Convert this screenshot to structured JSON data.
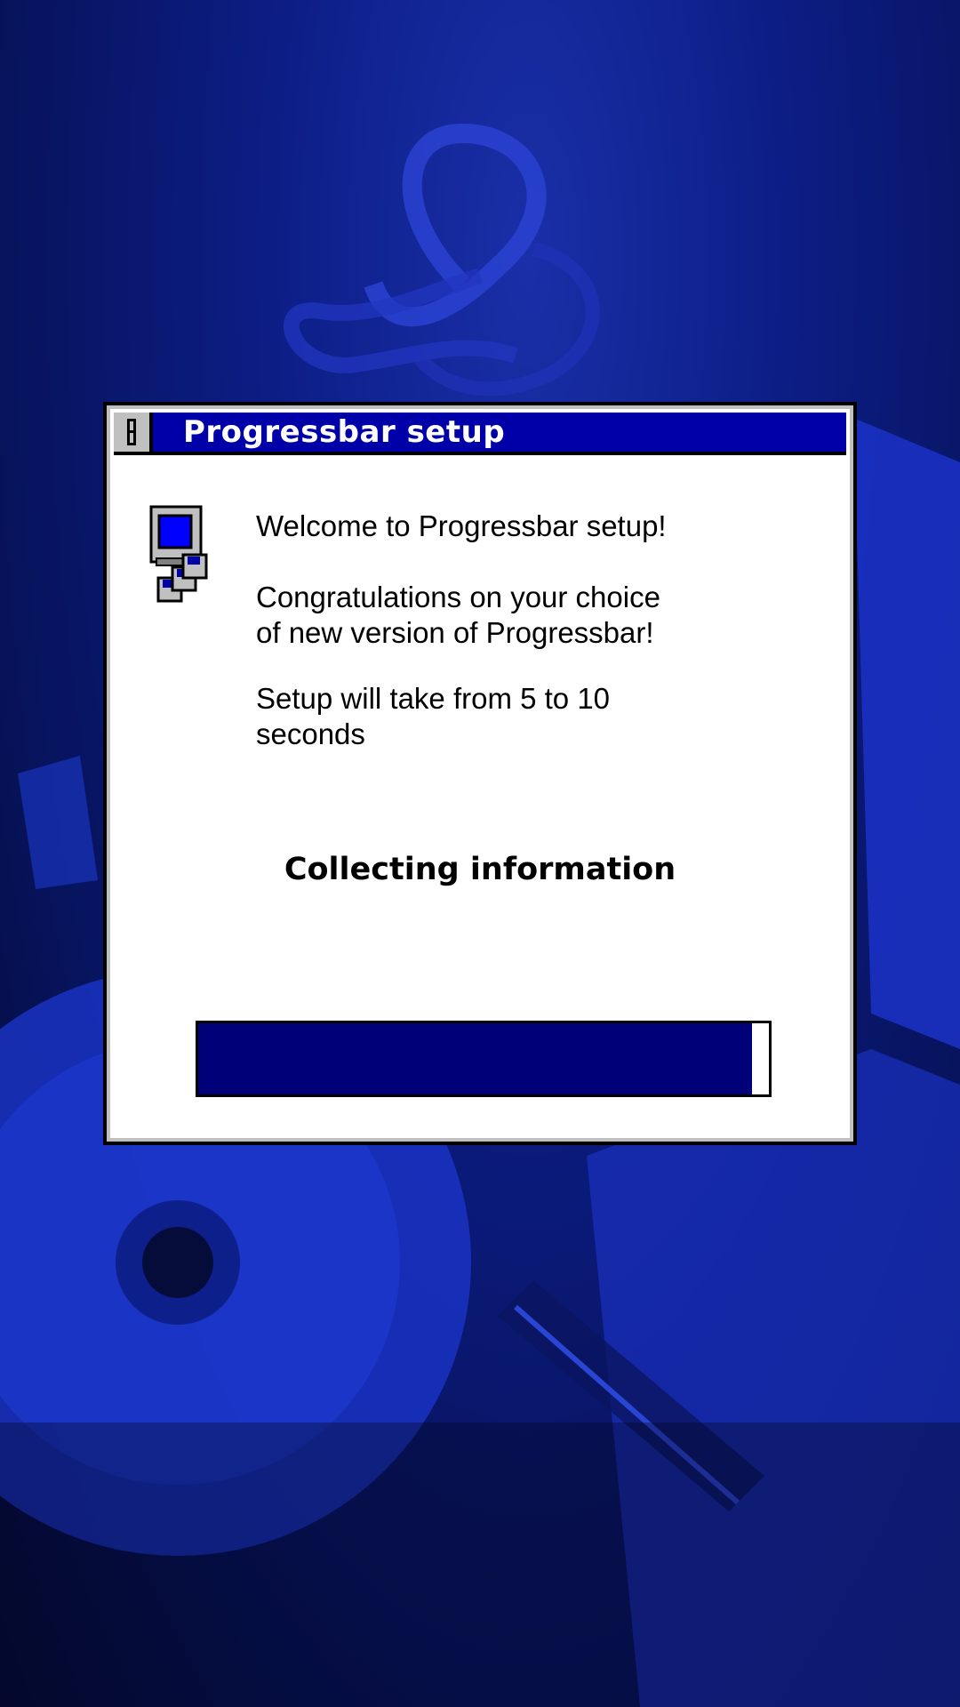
{
  "window": {
    "title": "Progressbar setup"
  },
  "icons": {
    "system_menu": "system-menu-icon",
    "setup": "setup-computer-disks-icon"
  },
  "messages": {
    "welcome": "Welcome to Progressbar setup!",
    "congrats": "Congratulations on your choice\nof new version of Progressbar!",
    "duration": "Setup will take from 5 to 10\nseconds"
  },
  "status": "Collecting information",
  "progress": {
    "fraction": 0.97,
    "fill_color": "#000078"
  },
  "colors": {
    "titlebar": "#0000a8",
    "wallpaper": "#0c1d85"
  }
}
